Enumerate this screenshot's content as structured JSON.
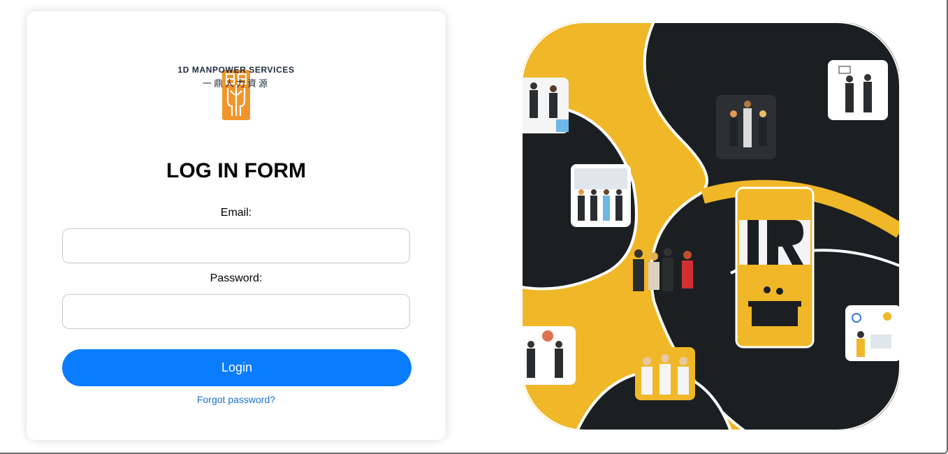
{
  "brand": {
    "name_en": "1D MANPOWER SERVICES",
    "name_cn": "一鼎人力資源",
    "logo_icon": "ding-logo-icon",
    "logo_color": "#f0952d"
  },
  "form": {
    "title": "LOG IN FORM",
    "email_label": "Email:",
    "email_value": "",
    "password_label": "Password:",
    "password_value": "",
    "login_label": "Login",
    "forgot_label": "Forgot password?"
  },
  "colors": {
    "primary": "#0a7cff",
    "link": "#1a72d0",
    "hero_yellow": "#f0b728",
    "hero_dark": "#1c1f21"
  },
  "hero": {
    "description_icon": "team-illustration-icon",
    "center_tile_letters": "IR"
  }
}
